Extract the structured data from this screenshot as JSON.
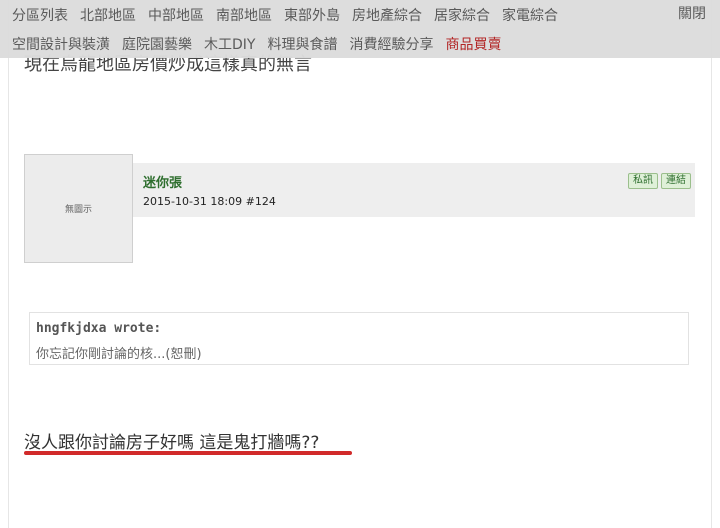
{
  "menu": {
    "row1": [
      "分區列表",
      "北部地區",
      "中部地區",
      "南部地區",
      "東部外島",
      "房地產綜合",
      "居家綜合",
      "家電綜合"
    ],
    "row2": [
      "空間設計與裝潢",
      "庭院園藝樂",
      "木工DIY",
      "料理與食譜",
      "消費經驗分享",
      "商品買賣"
    ],
    "active": "商品買賣",
    "close_label": "關閉"
  },
  "previous_post": {
    "text": "現在烏龍地區房價炒成這樣真的無言"
  },
  "post": {
    "avatar_text": "無圖示",
    "author": "迷你張",
    "datetime": "2015-10-31 18:09",
    "post_number": "#124",
    "pm_label": "私訊",
    "link_label": "連結",
    "quote": {
      "author": "hngfkjdxa wrote:",
      "text": "你忘記你剛討論的核...(恕刪)"
    },
    "reply": "沒人跟你討論房子好嗎 這是鬼打牆嗎??"
  },
  "colors": {
    "menu_bg": "#dcdcdc",
    "active_menu": "#b01c1c",
    "author_name": "#2e6e2e",
    "underline": "#d12a2a"
  }
}
